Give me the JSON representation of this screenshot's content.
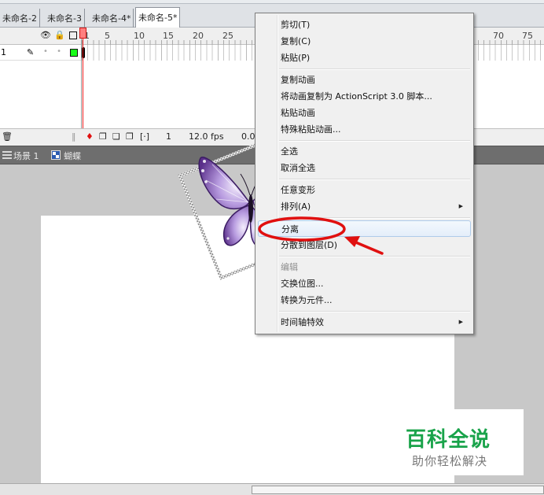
{
  "tabs": [
    "未命名-2",
    "未命名-3",
    "未命名-4*",
    "未命名-5*"
  ],
  "timeline": {
    "ruler": [
      "1",
      "5",
      "10",
      "15",
      "20",
      "25",
      "70",
      "75"
    ],
    "layer": {
      "name": "1"
    },
    "footer": {
      "frame": "1",
      "fps": "12.0 fps",
      "time": "0.0"
    }
  },
  "breadcrumb": {
    "scene": "场景 1",
    "symbol": "蝴蝶"
  },
  "context_menu": {
    "cut": "剪切(T)",
    "copy": "复制(C)",
    "paste": "粘贴(P)",
    "copy_motion": "复制动画",
    "copy_motion_as3": "将动画复制为 ActionScript 3.0 脚本...",
    "paste_motion": "粘贴动画",
    "paste_special": "特殊粘贴动画...",
    "select_all": "全选",
    "deselect_all": "取消全选",
    "free_transform": "任意变形",
    "arrange": "排列(A)",
    "break_apart": "分离",
    "distribute_layers": "分散到图层(D)",
    "edit": "编辑",
    "swap_bitmap": "交换位图...",
    "convert_symbol": "转换为元件...",
    "timeline_effects": "时间轴特效"
  },
  "watermark": {
    "title": "百科全说",
    "subtitle": "助你轻松解决"
  },
  "colors": {
    "highlight_ring": "#e01010",
    "watermark_green": "#19a34a",
    "layer_color": "#19ff19",
    "playhead": "#ee1a1a"
  }
}
